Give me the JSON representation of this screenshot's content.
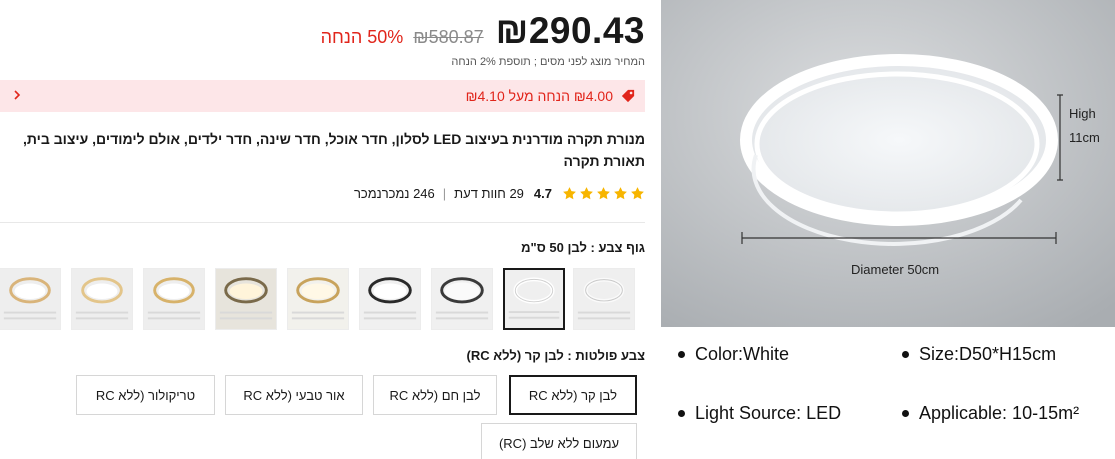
{
  "price": {
    "current": "₪290.43",
    "original": "₪580.87",
    "discount": "50% הנחה",
    "tax_note": "המחיר מוצג לפני מסים ; תוספת 2% הנחה"
  },
  "coupon": {
    "text": "₪4.00 הנחה מעל ₪4.10"
  },
  "product": {
    "title": "מנורת תקרה מודרנית בעיצוב LED לסלון, חדר אוכל, חדר שינה, חדר ילדים, אולם לימודים, עיצוב בית, תאורת תקרה"
  },
  "rating": {
    "value": "4.7",
    "stars": 5,
    "reviews": "29 חוות דעת",
    "sold": "246 נמכרנמכר"
  },
  "colors": {
    "accent": "#e1251b",
    "coupon_bg": "#fde6e8",
    "star": "#f7b500"
  },
  "body_color": {
    "label": "גוף צבע : לבן 50 ס\"מ",
    "selected_index": 0,
    "swatch_count": 9
  },
  "rc_color": {
    "label": "צבע פולטות : לבן קר (ללא RC)",
    "options": [
      "לבן קר (ללא RC",
      "לבן חם (ללא RC",
      "אור טבעי (ללא RC",
      "טריקולור (ללא RC",
      "עמעום ללא שלב (RC)"
    ],
    "selected_index": 0
  },
  "image": {
    "high_label": "High",
    "height_value": "11cm",
    "diameter_label": "Diameter 50cm"
  },
  "specs": {
    "color": "Color:White",
    "size": "Size:D50*H15cm",
    "light_source": "Light Source: LED",
    "applicable": "Applicable: 10-15m²"
  }
}
